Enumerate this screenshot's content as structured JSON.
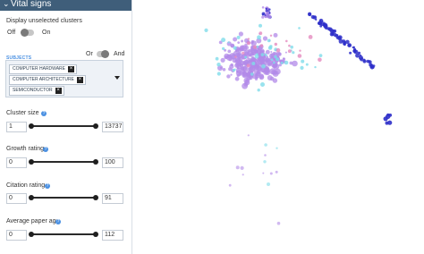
{
  "panel": {
    "title": "Vital signs",
    "unselected_label": "Display unselected clusters",
    "off_label": "Off",
    "on_label": "On",
    "or_label": "Or",
    "and_label": "And",
    "subjects_label": "SUBJECTS",
    "subjects": [
      "COMPUTER HARDWARE",
      "COMPUTER ARCHITECTURE",
      "SEMICONDUCTOR"
    ],
    "cluster_size": {
      "label": "Cluster size",
      "min": "1",
      "max": "13737",
      "low_fraction": 0.0,
      "high_fraction": 1.0
    },
    "growth_rating": {
      "label": "Growth rating",
      "min": "0",
      "max": "100",
      "low_fraction": 0.0,
      "high_fraction": 1.0
    },
    "citation_rating": {
      "label": "Citation rating",
      "min": "0",
      "max": "91",
      "low_fraction": 0.0,
      "high_fraction": 1.0
    },
    "paper_age": {
      "label": "Average paper age",
      "min": "0",
      "max": "112",
      "low_fraction": 0.0,
      "high_fraction": 1.0
    }
  },
  "colors": {
    "header_bg": "#3f5e7a",
    "accent": "#4a90e2",
    "cluster_purple": "#b28ae8",
    "cluster_cyan": "#7fdcea",
    "cluster_navy": "#2e2fc9",
    "cluster_pink": "#e58bbf"
  },
  "icons": {
    "collapse": "chevron-down-icon",
    "help": "question-circle-icon",
    "remove_tag": "close-icon",
    "dropdown": "caret-down-icon"
  }
}
